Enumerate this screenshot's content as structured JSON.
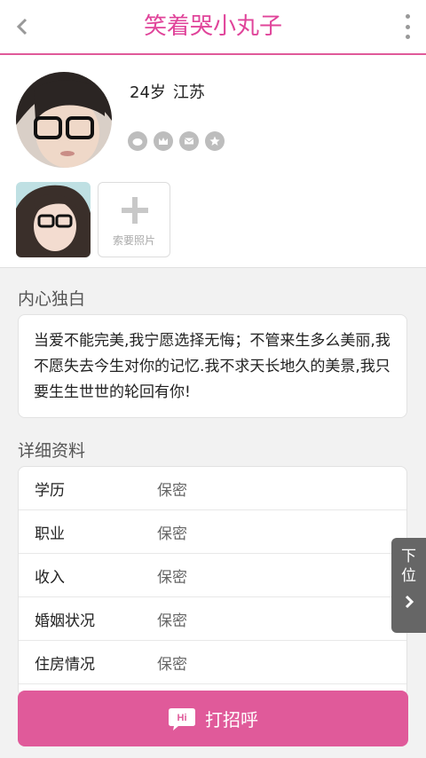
{
  "header": {
    "title": "笑着哭小丸子",
    "back_icon": "chevron-left-icon",
    "menu_icon": "more-vertical-icon"
  },
  "profile": {
    "age": "24岁",
    "location": "江苏",
    "badges": [
      "weibo-icon",
      "crown-icon",
      "mail-icon",
      "star-icon"
    ],
    "request_photo_label": "索要照片"
  },
  "monologue": {
    "title": "内心独白",
    "text": "当爱不能完美,我宁愿选择无悔；不管来生多么美丽,我不愿失去今生对你的记忆.我不求天长地久的美景,我只要生生世世的轮回有你!"
  },
  "details": {
    "title": "详细资料",
    "rows": [
      {
        "label": "学历",
        "value": "保密"
      },
      {
        "label": "职业",
        "value": "保密"
      },
      {
        "label": "收入",
        "value": "保密"
      },
      {
        "label": "婚姻状况",
        "value": "保密"
      },
      {
        "label": "住房情况",
        "value": "保密"
      }
    ]
  },
  "next_tab": {
    "line1": "下",
    "line2": "位"
  },
  "cta": {
    "label": "打招呼",
    "icon_text": "Hi"
  },
  "colors": {
    "accent": "#e05a9a",
    "title": "#e0449a"
  }
}
